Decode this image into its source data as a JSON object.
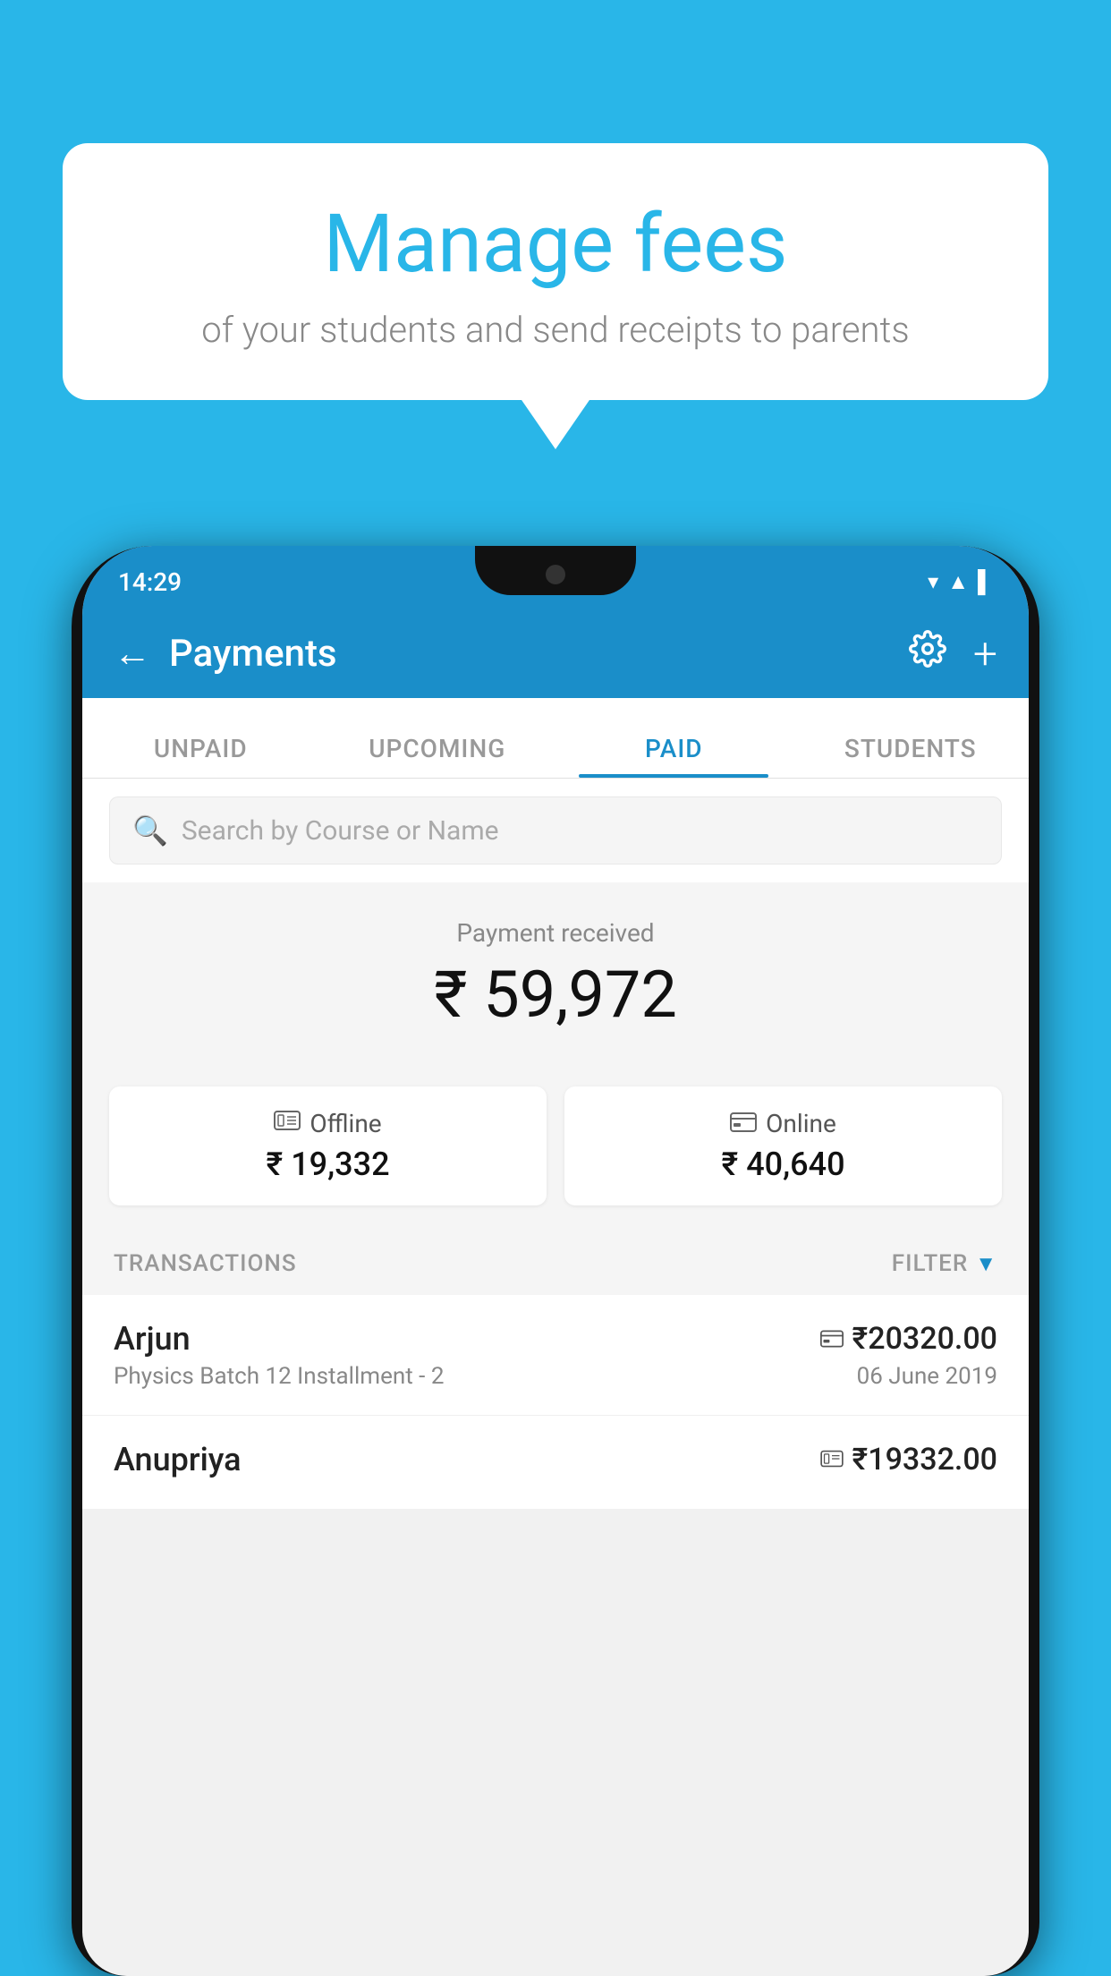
{
  "background_color": "#29B6E8",
  "bubble": {
    "title": "Manage fees",
    "subtitle": "of your students and send receipts to parents"
  },
  "status_bar": {
    "time": "14:29",
    "icons": [
      "wifi",
      "signal",
      "battery"
    ]
  },
  "top_bar": {
    "title": "Payments",
    "back_label": "←",
    "settings_label": "⚙",
    "add_label": "+"
  },
  "tabs": [
    {
      "label": "UNPAID",
      "active": false
    },
    {
      "label": "UPCOMING",
      "active": false
    },
    {
      "label": "PAID",
      "active": true
    },
    {
      "label": "STUDENTS",
      "active": false
    }
  ],
  "search": {
    "placeholder": "Search by Course or Name"
  },
  "payment_received": {
    "label": "Payment received",
    "amount": "₹ 59,972"
  },
  "payment_cards": [
    {
      "type": "Offline",
      "amount": "₹ 19,332",
      "icon_type": "offline"
    },
    {
      "type": "Online",
      "amount": "₹ 40,640",
      "icon_type": "online"
    }
  ],
  "transactions": {
    "header_label": "TRANSACTIONS",
    "filter_label": "FILTER",
    "items": [
      {
        "name": "Arjun",
        "amount": "₹20320.00",
        "course": "Physics Batch 12 Installment - 2",
        "date": "06 June 2019",
        "payment_type": "online"
      },
      {
        "name": "Anupriya",
        "amount": "₹19332.00",
        "course": "",
        "date": "",
        "payment_type": "offline"
      }
    ]
  }
}
